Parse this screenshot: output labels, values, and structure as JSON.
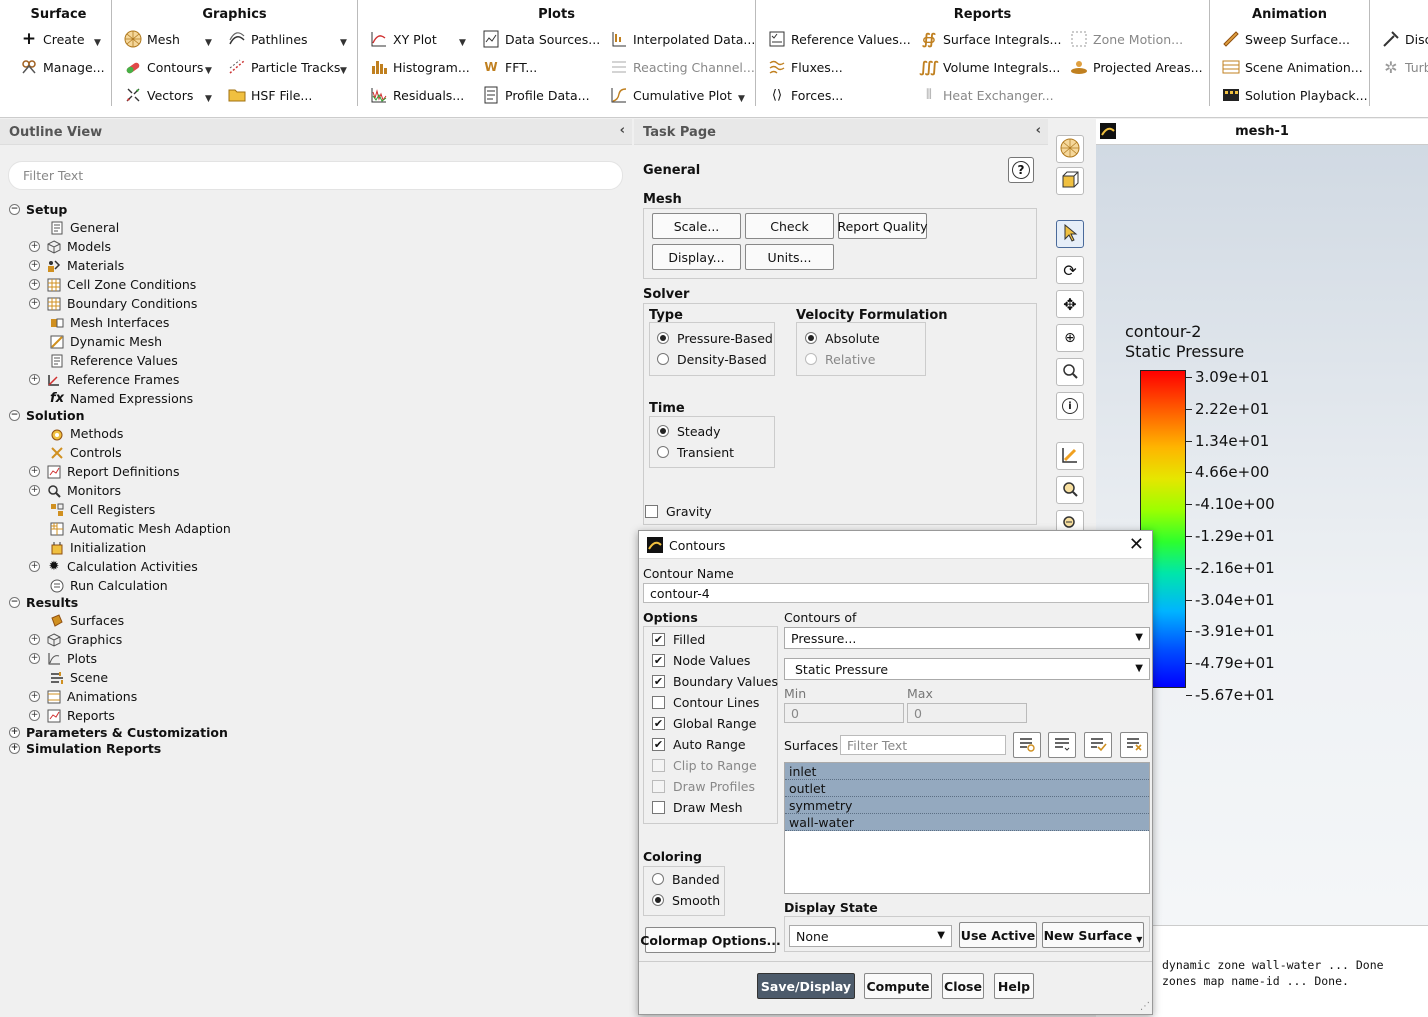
{
  "ribbon": {
    "groups": [
      {
        "title": "Surface",
        "items": [
          "Create",
          "Manage..."
        ]
      },
      {
        "title": "Graphics",
        "items": [
          "Mesh",
          "Contours",
          "Vectors",
          "Pathlines",
          "Particle Tracks",
          "HSF File..."
        ]
      },
      {
        "title": "Plots",
        "items": [
          "XY Plot",
          "Histogram...",
          "Residuals...",
          "Data Sources...",
          "FFT...",
          "Profile Data...",
          "Interpolated Data...",
          "Reacting Channel...",
          "Cumulative Plot"
        ]
      },
      {
        "title": "Reports",
        "items": [
          "Reference Values...",
          "Fluxes...",
          "Forces...",
          "Surface Integrals...",
          "Volume Integrals...",
          "Heat Exchanger...",
          "Zone Motion...",
          "Projected Areas..."
        ]
      },
      {
        "title": "Animation",
        "items": [
          "Sweep Surface...",
          "Scene Animation...",
          "Solution Playback..."
        ]
      },
      {
        "title": "",
        "items": [
          "Disc",
          "Turb"
        ]
      }
    ]
  },
  "outline": {
    "title": "Outline View",
    "filter_placeholder": "Filter Text",
    "tree": [
      "Setup",
      "General",
      "Models",
      "Materials",
      "Cell Zone Conditions",
      "Boundary Conditions",
      "Mesh Interfaces",
      "Dynamic Mesh",
      "Reference Values",
      "Reference Frames",
      "Named Expressions",
      "Solution",
      "Methods",
      "Controls",
      "Report Definitions",
      "Monitors",
      "Cell Registers",
      "Automatic Mesh Adaption",
      "Initialization",
      "Calculation Activities",
      "Run Calculation",
      "Results",
      "Surfaces",
      "Graphics",
      "Plots",
      "Scene",
      "Animations",
      "Reports",
      "Parameters & Customization",
      "Simulation Reports"
    ]
  },
  "task": {
    "title": "Task Page",
    "heading": "General",
    "mesh_label": "Mesh",
    "mesh_buttons": [
      "Scale...",
      "Check",
      "Report Quality",
      "Display...",
      "Units..."
    ],
    "solver_label": "Solver",
    "type_label": "Type",
    "type_options": [
      "Pressure-Based",
      "Density-Based"
    ],
    "velocity_label": "Velocity Formulation",
    "velocity_options": [
      "Absolute",
      "Relative"
    ],
    "time_label": "Time",
    "time_options": [
      "Steady",
      "Transient"
    ],
    "gravity_label": "Gravity"
  },
  "graphics": {
    "window_title": "mesh-1",
    "legend_title_1": "contour-2",
    "legend_title_2": "Static Pressure",
    "legend_ticks": [
      "3.09e+01",
      "2.22e+01",
      "1.34e+01",
      "4.66e+00",
      "-4.10e+00",
      "-1.29e+01",
      "-2.16e+01",
      "-3.04e+01",
      "-3.91e+01",
      "-4.79e+01",
      "-5.67e+01"
    ],
    "console_lines": [
      "dynamic zone wall-water ... Done",
      "zones map name-id ... Done."
    ]
  },
  "dialog": {
    "title": "Contours",
    "contour_name_label": "Contour Name",
    "contour_name_value": "contour-4",
    "options_label": "Options",
    "options": [
      {
        "label": "Filled",
        "checked": true,
        "disabled": false
      },
      {
        "label": "Node Values",
        "checked": true,
        "disabled": false
      },
      {
        "label": "Boundary Values",
        "checked": true,
        "disabled": false
      },
      {
        "label": "Contour Lines",
        "checked": false,
        "disabled": false
      },
      {
        "label": "Global Range",
        "checked": true,
        "disabled": false
      },
      {
        "label": "Auto Range",
        "checked": true,
        "disabled": false
      },
      {
        "label": "Clip to Range",
        "checked": false,
        "disabled": true
      },
      {
        "label": "Draw Profiles",
        "checked": false,
        "disabled": true
      },
      {
        "label": "Draw Mesh",
        "checked": false,
        "disabled": false
      }
    ],
    "contours_of_label": "Contours of",
    "contours_of_value": "Pressure...",
    "contours_sub_value": "Static Pressure",
    "min_label": "Min",
    "max_label": "Max",
    "min_value": "0",
    "max_value": "0",
    "surfaces_label": "Surfaces",
    "surfaces_filter_placeholder": "Filter Text",
    "surfaces": [
      "inlet",
      "outlet",
      "symmetry",
      "wall-water"
    ],
    "coloring_label": "Coloring",
    "coloring_options": [
      "Banded",
      "Smooth"
    ],
    "display_state_label": "Display State",
    "display_state_value": "None",
    "use_active_label": "Use Active",
    "new_surface_label": "New Surface",
    "colormap_label": "Colormap Options...",
    "buttons": [
      "Save/Display",
      "Compute",
      "Close",
      "Help"
    ]
  }
}
